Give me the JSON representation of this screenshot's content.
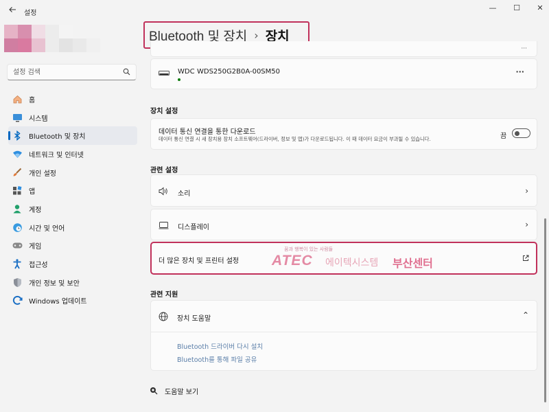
{
  "window": {
    "title": "설정",
    "back_icon": "back-arrow-icon",
    "minimize_label": "—",
    "maximize_label": "☐",
    "close_label": "✕"
  },
  "search": {
    "placeholder": "설정 검색",
    "value": ""
  },
  "sidebar": {
    "items": [
      {
        "label": "홈",
        "icon": "home-icon"
      },
      {
        "label": "시스템",
        "icon": "system-icon"
      },
      {
        "label": "Bluetooth 및 장치",
        "icon": "bluetooth-icon",
        "active": true
      },
      {
        "label": "네트워크 및 인터넷",
        "icon": "network-icon"
      },
      {
        "label": "개인 설정",
        "icon": "brush-icon"
      },
      {
        "label": "앱",
        "icon": "apps-icon"
      },
      {
        "label": "계정",
        "icon": "account-icon"
      },
      {
        "label": "시간 및 언어",
        "icon": "time-language-icon"
      },
      {
        "label": "게임",
        "icon": "gamepad-icon"
      },
      {
        "label": "접근성",
        "icon": "accessibility-icon"
      },
      {
        "label": "개인 정보 및 보안",
        "icon": "shield-icon"
      },
      {
        "label": "Windows 업데이트",
        "icon": "update-icon"
      }
    ]
  },
  "header": {
    "crumb": "Bluetooth 및 장치",
    "separator": "›",
    "current": "장치"
  },
  "device": {
    "name": "WDC",
    "model": "WDS250G2B0A-00SM50",
    "more_label": "···"
  },
  "device_settings": {
    "heading": "장치 설정",
    "title": "데이터 통신 연결을 통한 다운로드",
    "description": "데이터 통신 연결 시 새 장치용 장치 소프트웨어(드라이버, 정보 및 앱)가 다운로드됩니다. 이 때 데이터 요금이 부과될 수 있습니다.",
    "toggle_label": "끔",
    "toggle_on": false
  },
  "related_settings": {
    "heading": "관련 설정",
    "items": [
      {
        "label": "소리",
        "icon": "speaker-icon"
      },
      {
        "label": "디스플레이",
        "icon": "display-icon"
      },
      {
        "label": "더 많은 장치 및 프린터 설정",
        "icon": "external-link-icon"
      }
    ]
  },
  "watermark": {
    "tagline": "꿈과 행복이 있는 사람들",
    "brand": "ATEC",
    "company": "에이텍시스템",
    "center": "부산센터"
  },
  "related_support": {
    "heading": "관련 지원",
    "title": "장치 도움말",
    "links": [
      "Bluetooth 드라이버 다시 설치",
      "Bluetooth를 통해 파일 공유"
    ]
  },
  "footer": {
    "help_label": "도움말 보기"
  },
  "colors": {
    "accent": "#0067c0",
    "highlight_border": "#c0305a",
    "link": "#5a7ea8",
    "status_green": "#107c10"
  }
}
